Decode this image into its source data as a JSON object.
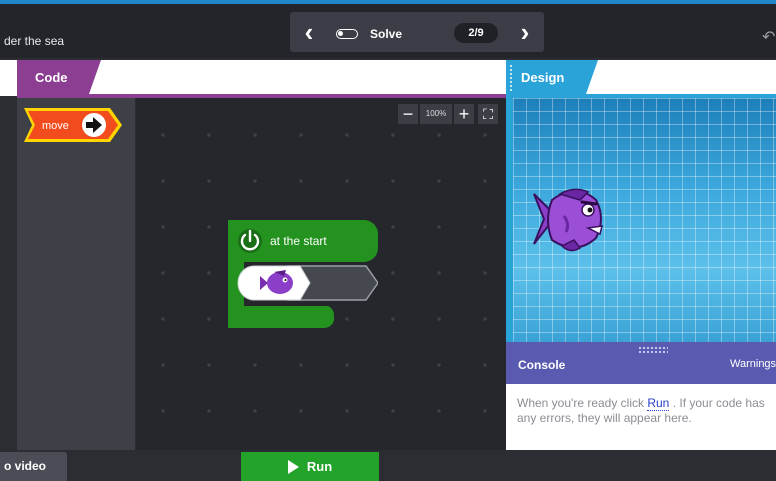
{
  "topbar": {
    "lesson_title": "der the sea",
    "nav": {
      "prev_icon": "chevron-left-icon",
      "next_icon": "chevron-right-icon",
      "prev": "‹",
      "next": "›"
    },
    "mode_label": "Solve",
    "progress_counter": "2/9",
    "undo_glyph": "↶"
  },
  "code_panel": {
    "tab_label": "Code",
    "palette_blocks": [
      {
        "label": "move",
        "icon": "arrow-right-icon",
        "color": "#f24b1d"
      }
    ],
    "zoom": {
      "minus": "−",
      "level": "100%",
      "plus": "+",
      "fullscreen": "⛶"
    },
    "program": {
      "event_block": {
        "label": "at the start",
        "icon": "power-icon",
        "color": "#23921f"
      },
      "sprite_slot": {
        "sprite": "purple-fish",
        "icon": "fish-icon"
      }
    }
  },
  "design_panel": {
    "tab_label": "Design",
    "background": "underwater",
    "sprite": "purple-fish"
  },
  "console": {
    "title": "Console",
    "warnings_label": "Warnings",
    "message_before": "When you're ready click ",
    "message_link": "Run",
    "message_after": " . If your code has any errors, they will appear here."
  },
  "bottombar": {
    "video_label": "o video",
    "run_label": "Run",
    "run_icon": "play-icon"
  },
  "colors": {
    "code_accent": "#8c3e93",
    "design_accent": "#2aa3d9",
    "console_header": "#5a5bb0",
    "run_button": "#24a32a",
    "block_green": "#23921f",
    "move_block": "#f24b1d"
  }
}
